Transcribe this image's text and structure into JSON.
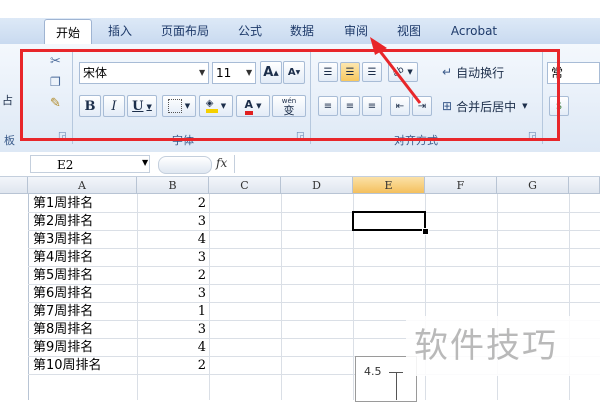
{
  "tabs": [
    "开始",
    "插入",
    "页面布局",
    "公式",
    "数据",
    "审阅",
    "视图",
    "Acrobat"
  ],
  "font_group": {
    "font_name": "宋体",
    "font_size": "11",
    "grow_label": "A",
    "shrink_label": "A",
    "bold": "B",
    "italic": "I",
    "underline": "U",
    "font_color_label": "A",
    "phonetic_label": "wén",
    "phonetic_char": "变",
    "group_label": "字体"
  },
  "clipboard_group": {
    "paste_label": "占",
    "group_label": "板"
  },
  "alignment_group": {
    "wrap_text": "自动换行",
    "merge_center": "合并后居中",
    "group_label": "对齐方式",
    "orientation_label": "ab"
  },
  "number_group": {
    "format_label": "常"
  },
  "formula_bar": {
    "name_box": "E2",
    "fx": "fx",
    "formula": ""
  },
  "columns": [
    "A",
    "B",
    "C",
    "D",
    "E",
    "F",
    "G"
  ],
  "selected_column": "E",
  "rows": [
    {
      "a": "第1周排名",
      "b": "2"
    },
    {
      "a": "第2周排名",
      "b": "3"
    },
    {
      "a": "第3周排名",
      "b": "4"
    },
    {
      "a": "第4周排名",
      "b": "3"
    },
    {
      "a": "第5周排名",
      "b": "2"
    },
    {
      "a": "第6周排名",
      "b": "3"
    },
    {
      "a": "第7周排名",
      "b": "1"
    },
    {
      "a": "第8周排名",
      "b": "3"
    },
    {
      "a": "第9周排名",
      "b": "4"
    },
    {
      "a": "第10周排名",
      "b": "2"
    }
  ],
  "chart_axis_label": "4.5",
  "watermark": "软件技巧",
  "colors": {
    "annotation_red": "#e8262a",
    "selected_header": "#f4c05e",
    "ribbon": "#dde8f5"
  }
}
